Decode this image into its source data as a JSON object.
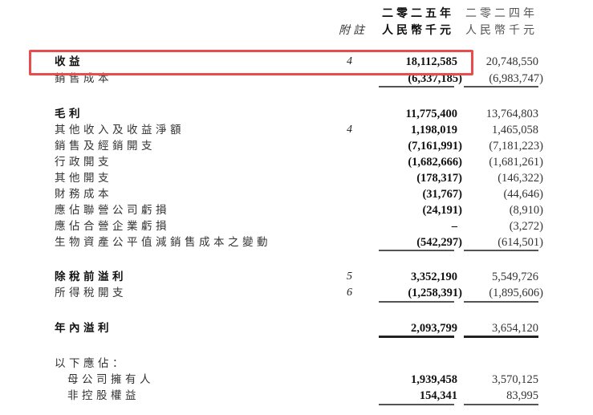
{
  "header": {
    "note_label": "附註",
    "col_2025_year": "二零二五年",
    "col_2025_unit": "人民幣千元",
    "col_2024_year": "二零二四年",
    "col_2024_unit": "人民幣千元"
  },
  "rows": [
    {
      "label": "收益",
      "note": "4",
      "v2025": "18,112,585",
      "v2024": "20,748,550"
    },
    {
      "label": "銷售成本",
      "note": "",
      "v2025": "(6,337,185)",
      "v2024": "(6,983,747)"
    },
    {
      "label": "毛利",
      "note": "",
      "v2025": "11,775,400",
      "v2024": "13,764,803"
    },
    {
      "label": "其他收入及收益淨額",
      "note": "4",
      "v2025": "1,198,019",
      "v2024": "1,465,058"
    },
    {
      "label": "銷售及經銷開支",
      "note": "",
      "v2025": "(7,161,991)",
      "v2024": "(7,181,223)"
    },
    {
      "label": "行政開支",
      "note": "",
      "v2025": "(1,682,666)",
      "v2024": "(1,681,261)"
    },
    {
      "label": "其他開支",
      "note": "",
      "v2025": "(178,317)",
      "v2024": "(146,322)"
    },
    {
      "label": "財務成本",
      "note": "",
      "v2025": "(31,767)",
      "v2024": "(44,646)"
    },
    {
      "label": "應佔聯營公司虧損",
      "note": "",
      "v2025": "(24,191)",
      "v2024": "(8,910)"
    },
    {
      "label": "應佔合營企業虧損",
      "note": "",
      "v2025": "–",
      "v2024": "(3,272)"
    },
    {
      "label": "生物資產公平值減銷售成本之變動",
      "note": "",
      "v2025": "(542,297)",
      "v2024": "(614,501)"
    },
    {
      "label": "除稅前溢利",
      "note": "5",
      "v2025": "3,352,190",
      "v2024": "5,549,726"
    },
    {
      "label": "所得稅開支",
      "note": "6",
      "v2025": "(1,258,391)",
      "v2024": "(1,895,606)"
    },
    {
      "label": "年內溢利",
      "note": "",
      "v2025": "2,093,799",
      "v2024": "3,654,120"
    },
    {
      "label": "以下應佔：",
      "note": "",
      "v2025": "",
      "v2024": ""
    },
    {
      "label": "母公司擁有人",
      "note": "",
      "v2025": "1,939,458",
      "v2024": "3,570,125"
    },
    {
      "label": "非控股權益",
      "note": "",
      "v2025": "154,341",
      "v2024": "83,995"
    }
  ],
  "highlight_color": "#e84c4c"
}
